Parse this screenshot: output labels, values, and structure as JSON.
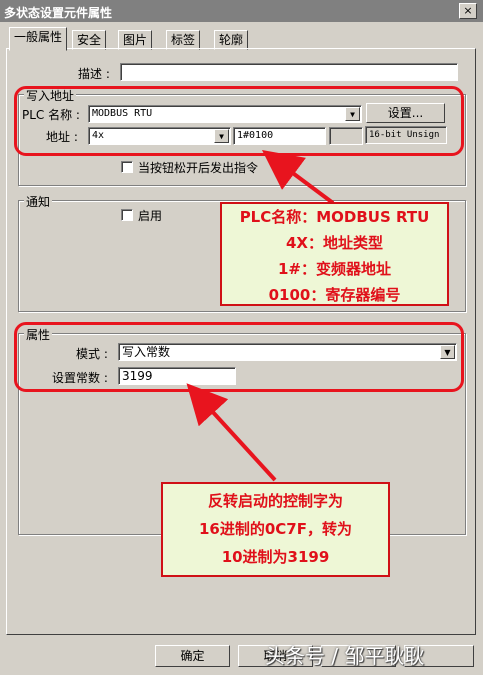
{
  "window": {
    "title": "多状态设置元件属性",
    "close_label": "×"
  },
  "tabs": [
    "一般属性",
    "安全",
    "图片",
    "标签",
    "轮廓"
  ],
  "description": {
    "label": "描述 :",
    "value": ""
  },
  "write_address": {
    "group_label": "写入地址",
    "plc_label": "PLC 名称 :",
    "plc_value": "MODBUS RTU",
    "settings_button": "设置...",
    "address_label": "地址 :",
    "address_type": "4x",
    "address_value": "1#0100",
    "address_extra": "",
    "data_format": "16-bit Unsign",
    "release_checkbox_label": "当按钮松开后发出指令"
  },
  "notification": {
    "group_label": "通知",
    "enable_label": "启用"
  },
  "attributes": {
    "group_label": "属性",
    "mode_label": "模式 :",
    "mode_value": "写入常数",
    "constant_label": "设置常数 :",
    "constant_value": "3199"
  },
  "annotations": {
    "note1_lines": [
      "PLC名称：MODBUS RTU",
      "4X：地址类型",
      "1#：变频器地址",
      "0100：寄存器编号"
    ],
    "note2_lines": [
      "反转启动的控制字为",
      "16进制的0C7F，转为",
      "10进制为3199"
    ],
    "highlight_color": "#e8141e",
    "note_background": "#eef7d6"
  },
  "buttons": {
    "ok": "确定",
    "cancel": "取消"
  },
  "watermark": "头条号 / 邹平耿耿"
}
